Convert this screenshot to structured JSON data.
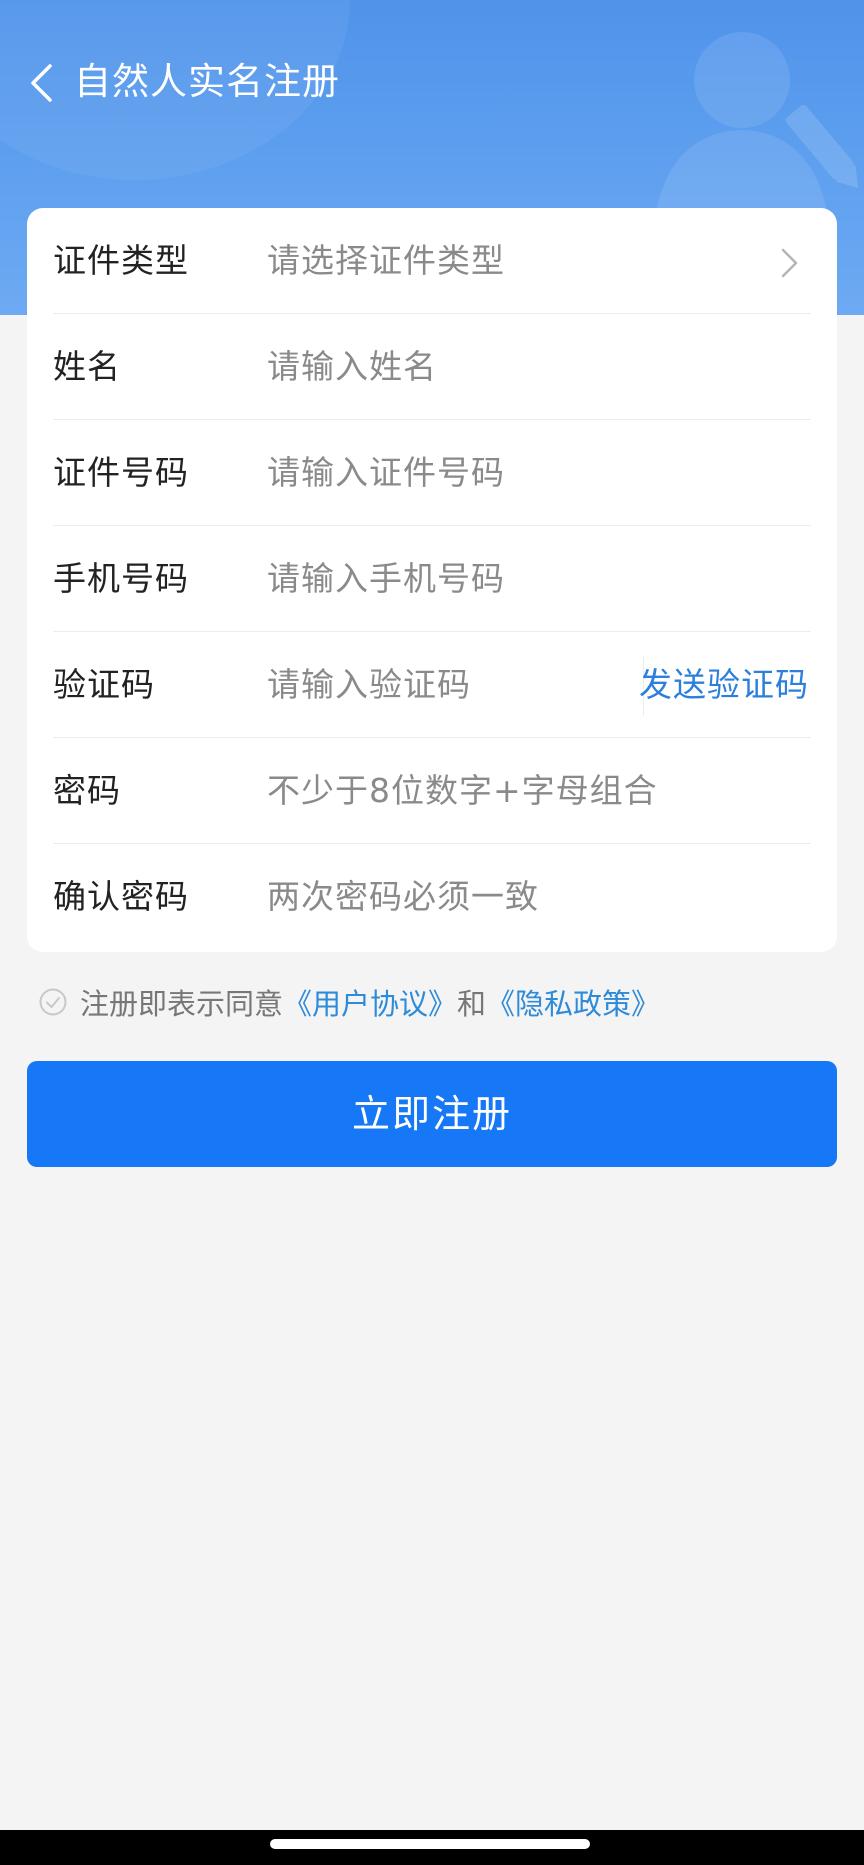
{
  "header": {
    "title": "自然人实名注册",
    "back_icon": "chevron-left-icon",
    "background_color": "#5a9cee"
  },
  "form": {
    "rows": [
      {
        "label": "证件类型",
        "placeholder": "请选择证件类型",
        "icon": "chevron-right-icon"
      },
      {
        "label": "姓名",
        "placeholder": "请输入姓名"
      },
      {
        "label": "证件号码",
        "placeholder": "请输入证件号码"
      },
      {
        "label": "手机号码",
        "placeholder": "请输入手机号码"
      },
      {
        "label": "验证码",
        "placeholder": "请输入验证码",
        "action": "发送验证码"
      },
      {
        "label": "密码",
        "placeholder": "不少于8位数字+字母组合"
      },
      {
        "label": "确认密码",
        "placeholder": "两次密码必须一致"
      }
    ]
  },
  "agreement": {
    "prefix": "注册即表示同意",
    "user_agreement": "《用户协议》",
    "conjunction": "和",
    "privacy_policy": "《隐私政策》",
    "link_color": "#2d8bd9"
  },
  "submit": {
    "label": "立即注册",
    "color": "#1677f7"
  }
}
